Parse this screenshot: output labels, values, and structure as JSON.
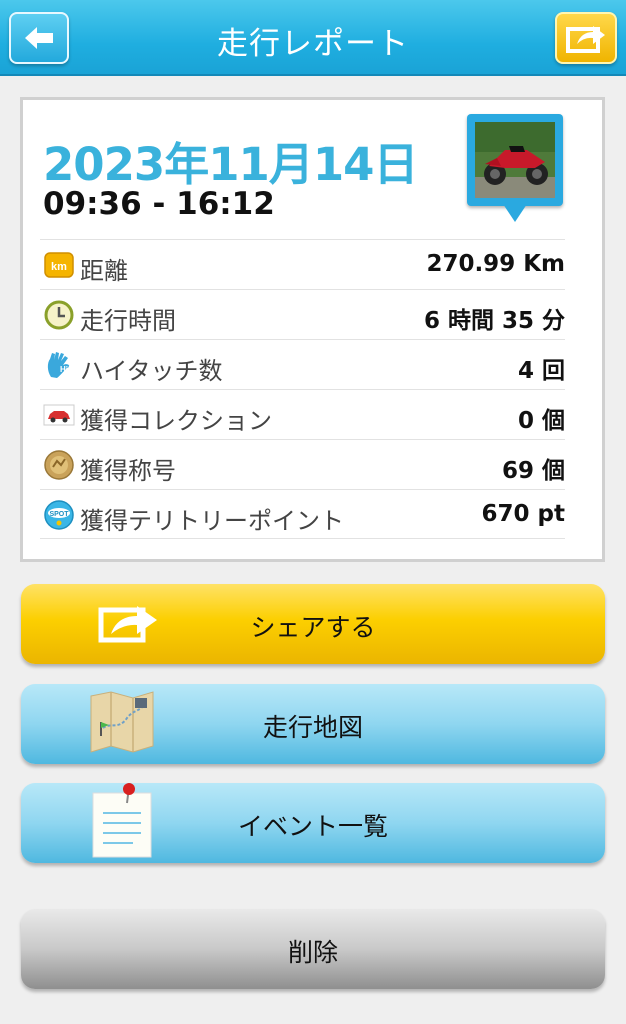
{
  "header": {
    "title": "走行レポート",
    "back_icon": "back-arrow-icon",
    "share_icon": "share-icon"
  },
  "report": {
    "date": "2023年11月14日",
    "time_range": "09:36 - 16:12",
    "photo_icon": "motorcycle-photo-icon",
    "stats": [
      {
        "icon": "km-icon",
        "label": "距離",
        "value": "270.99 Km"
      },
      {
        "icon": "clock-icon",
        "label": "走行時間",
        "value": "6 時間 35 分"
      },
      {
        "icon": "high-touch-icon",
        "label": "ハイタッチ数",
        "value": "4 回"
      },
      {
        "icon": "car-icon",
        "label": "獲得コレクション",
        "value": "0 個"
      },
      {
        "icon": "medal-icon",
        "label": "獲得称号",
        "value": "69 個"
      },
      {
        "icon": "spot-icon",
        "label": "獲得テリトリーポイント",
        "value": "670 pt"
      }
    ]
  },
  "buttons": {
    "share": "シェアする",
    "map": "走行地図",
    "events": "イベント一覧",
    "delete": "削除"
  },
  "colors": {
    "header_blue": "#1faee0",
    "date_blue": "#3ab2dc",
    "share_yellow": "#fccf00",
    "light_blue_button": "#8fd6f0",
    "delete_gray": "#c9c9c9"
  }
}
